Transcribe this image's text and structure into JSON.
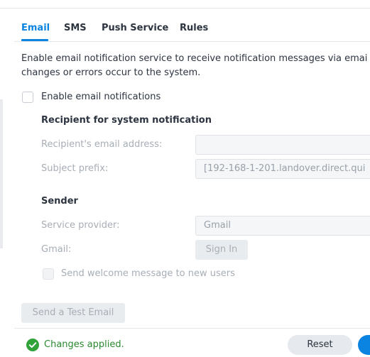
{
  "tabs": {
    "email": "Email",
    "sms": "SMS",
    "push": "Push Service",
    "rules": "Rules"
  },
  "description": {
    "line1": "Enable email notification service to receive notification messages via emai",
    "line2": "changes or errors occur to the system."
  },
  "enable_checkbox": {
    "label": "Enable email notifications",
    "checked": false
  },
  "recipient_section": {
    "title": "Recipient for system notification",
    "email_label": "Recipient's email address:",
    "email_value": "",
    "subject_label": "Subject prefix:",
    "subject_value": "[192-168-1-201.landover.direct.qui"
  },
  "sender_section": {
    "title": "Sender",
    "provider_label": "Service provider:",
    "provider_value": "Gmail",
    "gmail_label": "Gmail:",
    "signin_label": "Sign In",
    "welcome_label": "Send welcome message to new users",
    "welcome_checked": false
  },
  "test_email_button": "Send a Test Email",
  "status": {
    "text": "Changes applied.",
    "color": "#2a8a2f",
    "icon": "check-circle-icon"
  },
  "footer": {
    "reset_label": "Reset"
  },
  "colors": {
    "accent": "#0a84e0"
  }
}
